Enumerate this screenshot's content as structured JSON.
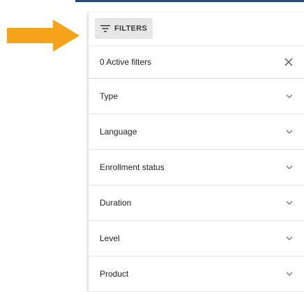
{
  "filters_button": {
    "label": "FILTERS",
    "icon": "filter-lines-icon"
  },
  "active_filters": {
    "label": "0 Active filters",
    "clear_icon": "close-icon"
  },
  "sections": [
    {
      "label": "Type"
    },
    {
      "label": "Language"
    },
    {
      "label": "Enrollment status"
    },
    {
      "label": "Duration"
    },
    {
      "label": "Level"
    },
    {
      "label": "Product"
    }
  ],
  "colors": {
    "arrow": "#f5a31a",
    "top_bar": "#2a4a7a",
    "button_bg": "#e6e6e6"
  }
}
